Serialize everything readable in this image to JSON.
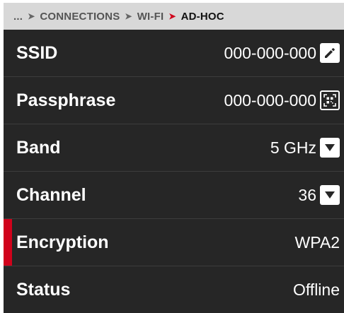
{
  "breadcrumb": {
    "ellipsis": "...",
    "items": [
      "CONNECTIONS",
      "WI-FI",
      "AD-HOC"
    ]
  },
  "settings": [
    {
      "label": "SSID",
      "value": "000-000-000",
      "icon": "edit-icon"
    },
    {
      "label": "Passphrase",
      "value": "000-000-000",
      "icon": "qr-code-icon"
    },
    {
      "label": "Band",
      "value": "5 GHz",
      "icon": "dropdown-icon"
    },
    {
      "label": "Channel",
      "value": "36",
      "icon": "dropdown-icon"
    },
    {
      "label": "Encryption",
      "value": "WPA2",
      "selected": true
    },
    {
      "label": "Status",
      "value": "Offline"
    }
  ],
  "colors": {
    "background": "#262626",
    "breadcrumb_bg": "#d8d8d8",
    "accent": "#d0021b",
    "text": "#ffffff"
  }
}
